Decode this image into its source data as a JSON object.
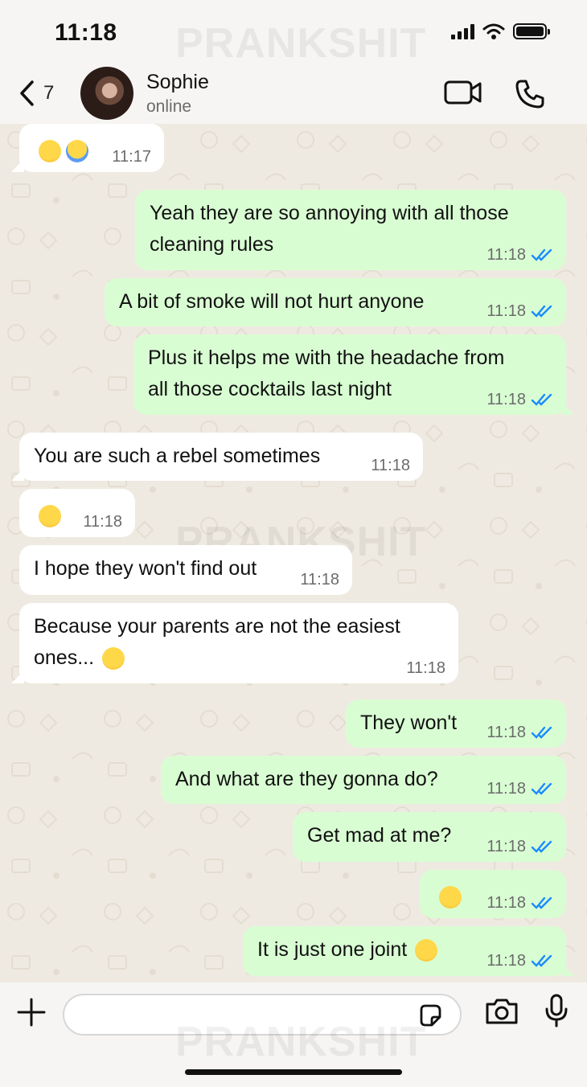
{
  "status_bar": {
    "time": "11:18"
  },
  "watermark": "PRANKSHIT",
  "header": {
    "back_count": "7",
    "contact_name": "Sophie",
    "contact_status": "online"
  },
  "messages": [
    {
      "dir": "in",
      "text": "",
      "emoji": [
        "joy",
        "scream"
      ],
      "time": "11:17"
    },
    {
      "dir": "out",
      "text": "Yeah they are so annoying with all those\ncleaning rules",
      "time": "11:18"
    },
    {
      "dir": "out",
      "text": "A bit of smoke will not hurt anyone",
      "time": "11:18"
    },
    {
      "dir": "out",
      "text": "Plus it helps me with the headache from\nall those cocktails last night",
      "time": "11:18"
    },
    {
      "dir": "in",
      "text": "You are such a rebel sometimes",
      "time": "11:18"
    },
    {
      "dir": "in",
      "text": "",
      "emoji": [
        "laughing"
      ],
      "time": "11:18"
    },
    {
      "dir": "in",
      "text": "I hope they won't find out",
      "time": "11:18"
    },
    {
      "dir": "in",
      "text": "Because your parents are not the easiest\nones...",
      "emoji": [
        "flushed"
      ],
      "time": "11:18"
    },
    {
      "dir": "out",
      "text": "They won't",
      "time": "11:18"
    },
    {
      "dir": "out",
      "text": "And what are they gonna do?",
      "time": "11:18"
    },
    {
      "dir": "out",
      "text": "Get mad at me?",
      "time": "11:18"
    },
    {
      "dir": "out",
      "text": "",
      "emoji": [
        "pleading"
      ],
      "time": "11:18"
    },
    {
      "dir": "out",
      "text": "It is just one joint",
      "emoji": [
        "tongue"
      ],
      "time": "11:18"
    }
  ],
  "colors": {
    "outgoing_bubble": "#d9fdd3",
    "incoming_bubble": "#ffffff",
    "read_check": "#1a8cff"
  },
  "icons": [
    "back-chevron",
    "video-call",
    "voice-call",
    "plus",
    "sticker",
    "camera",
    "microphone"
  ]
}
